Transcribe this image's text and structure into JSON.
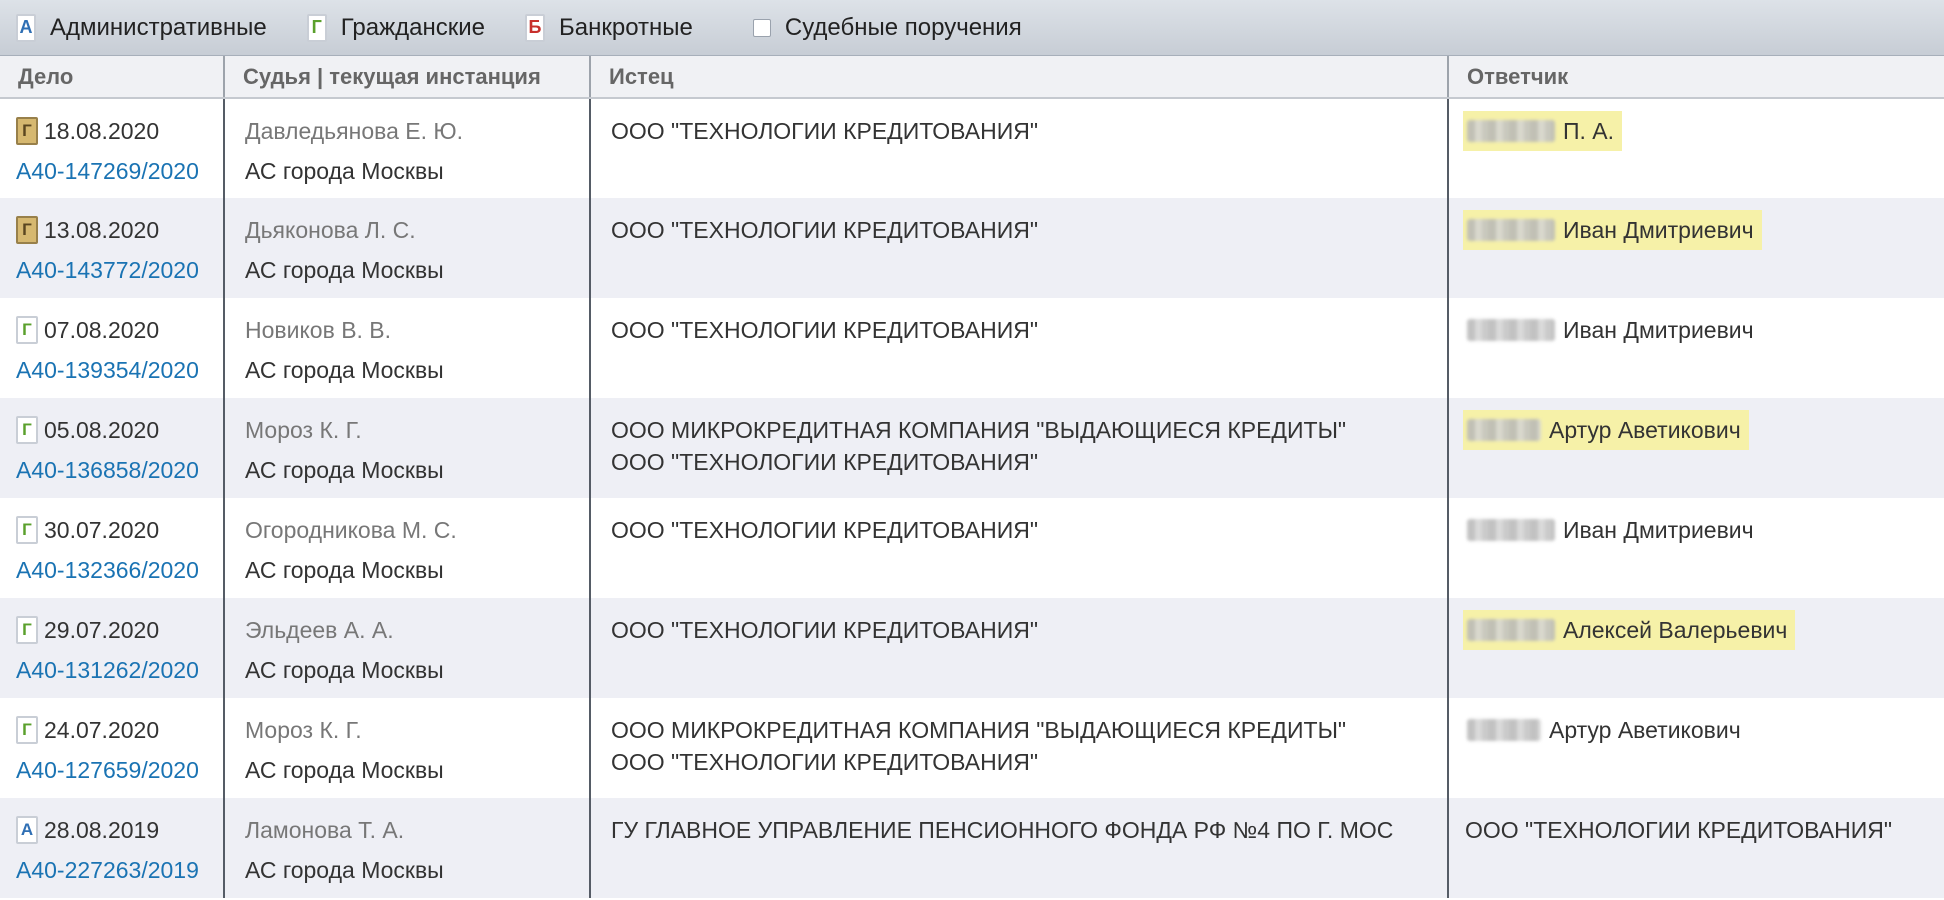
{
  "toolbar": {
    "filters": [
      {
        "label": "Административные",
        "icon_letter": "А",
        "icon_color": "#2f6fb4"
      },
      {
        "label": "Гражданские",
        "icon_letter": "Г",
        "icon_color": "#5aa02c"
      },
      {
        "label": "Банкротные",
        "icon_letter": "Б",
        "icon_color": "#c8302c"
      }
    ],
    "court_orders_label": "Судебные поручения"
  },
  "table": {
    "headers": {
      "case": "Дело",
      "judge": "Судья | текущая инстанция",
      "plaintiff": "Истец",
      "defendant": "Ответчик"
    },
    "rows": [
      {
        "icon_letter": "Г",
        "date": "18.08.2020",
        "case_number": "А40-147269/2020",
        "judge": "Давледьянова Е. Ю.",
        "court": "АС города Москвы",
        "plaintiffs": [
          "ООО \"ТЕХНОЛОГИИ КРЕДИТОВАНИЯ\""
        ],
        "defendant": "П. А."
      },
      {
        "icon_letter": "Г",
        "date": "13.08.2020",
        "case_number": "А40-143772/2020",
        "judge": "Дьяконова Л. С.",
        "court": "АС города Москвы",
        "plaintiffs": [
          "ООО \"ТЕХНОЛОГИИ КРЕДИТОВАНИЯ\""
        ],
        "defendant": "Иван Дмитриевич"
      },
      {
        "icon_letter": "Г",
        "date": "07.08.2020",
        "case_number": "А40-139354/2020",
        "judge": "Новиков В. В.",
        "court": "АС города Москвы",
        "plaintiffs": [
          "ООО \"ТЕХНОЛОГИИ КРЕДИТОВАНИЯ\""
        ],
        "defendant": "Иван Дмитриевич"
      },
      {
        "icon_letter": "Г",
        "date": "05.08.2020",
        "case_number": "А40-136858/2020",
        "judge": "Мороз К. Г.",
        "court": "АС города Москвы",
        "plaintiffs": [
          "ООО МИКРОКРЕДИТНАЯ КОМПАНИЯ \"ВЫДАЮЩИЕСЯ КРЕДИТЫ\"",
          "ООО \"ТЕХНОЛОГИИ КРЕДИТОВАНИЯ\""
        ],
        "defendant": "Артур Аветикович"
      },
      {
        "icon_letter": "Г",
        "date": "30.07.2020",
        "case_number": "А40-132366/2020",
        "judge": "Огородникова М. С.",
        "court": "АС города Москвы",
        "plaintiffs": [
          "ООО \"ТЕХНОЛОГИИ КРЕДИТОВАНИЯ\""
        ],
        "defendant": "Иван Дмитриевич"
      },
      {
        "icon_letter": "Г",
        "date": "29.07.2020",
        "case_number": "А40-131262/2020",
        "judge": "Эльдеев А. А.",
        "court": "АС города Москвы",
        "plaintiffs": [
          "ООО \"ТЕХНОЛОГИИ КРЕДИТОВАНИЯ\""
        ],
        "defendant": "Алексей Валерьевич"
      },
      {
        "icon_letter": "Г",
        "date": "24.07.2020",
        "case_number": "А40-127659/2020",
        "judge": "Мороз К. Г.",
        "court": "АС города Москвы",
        "plaintiffs": [
          "ООО МИКРОКРЕДИТНАЯ КОМПАНИЯ \"ВЫДАЮЩИЕСЯ КРЕДИТЫ\"",
          "ООО \"ТЕХНОЛОГИИ КРЕДИТОВАНИЯ\""
        ],
        "defendant": "Артур Аветикович"
      },
      {
        "icon_letter": "А",
        "date": "28.08.2019",
        "case_number": "А40-227263/2019",
        "judge": "Ламонова Т. А.",
        "court": "АС города Москвы",
        "plaintiffs": [
          "ГУ ГЛАВНОЕ УПРАВЛЕНИЕ ПЕНСИОННОГО ФОНДА РФ №4 ПО Г. МОС"
        ],
        "defendant": "ООО \"ТЕХНОЛОГИИ КРЕДИТОВАНИЯ\""
      }
    ]
  },
  "colors": {
    "link": "#1a73b3",
    "highlight": "#f6f1a8",
    "zebra": "#eeeff5"
  }
}
